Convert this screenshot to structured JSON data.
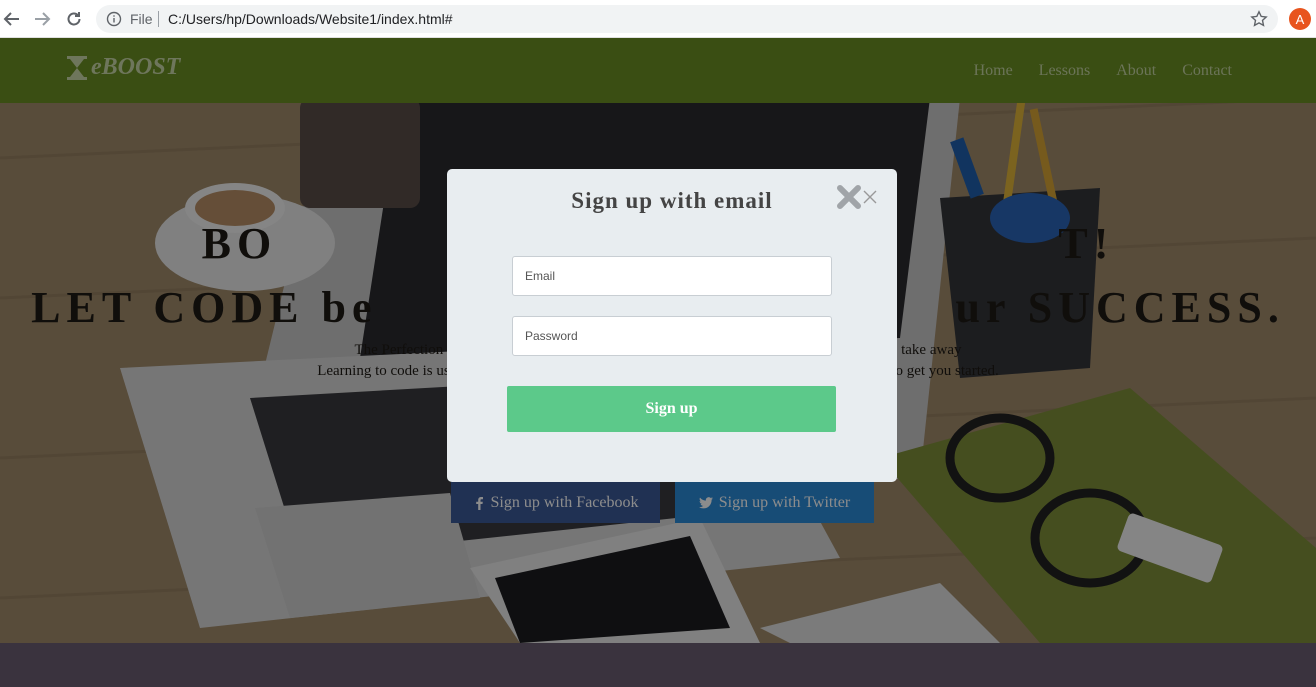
{
  "browser": {
    "scheme_label": "File",
    "url": "C:/Users/hp/Downloads/Website1/index.html#",
    "profile_initial": "A"
  },
  "navbar": {
    "logo_text": "eBOOST",
    "links": [
      "Home",
      "Lessons",
      "About",
      "Contact"
    ]
  },
  "hero": {
    "headline_1": "BO                                              T!",
    "headline_2": "LET CODE be                                  ur SUCCESS.",
    "paragraph_1": "The Perfection in De                                                                                                   thing to take away",
    "paragraph_2": "Learning to code is useful no m                                                                                   nvironment to get you started.",
    "facebook_label": "Sign up with Facebook",
    "twitter_label": "Sign up with Twitter"
  },
  "modal": {
    "title": "Sign up with email",
    "email_placeholder": "Email",
    "password_placeholder": "Password",
    "submit_label": "Sign up"
  },
  "colors": {
    "navbar": "#6b8e23",
    "signup_button": "#5cc98a",
    "facebook": "#3b5998",
    "twitter": "#2a8ad8",
    "modal_bg": "#e8edf0"
  }
}
